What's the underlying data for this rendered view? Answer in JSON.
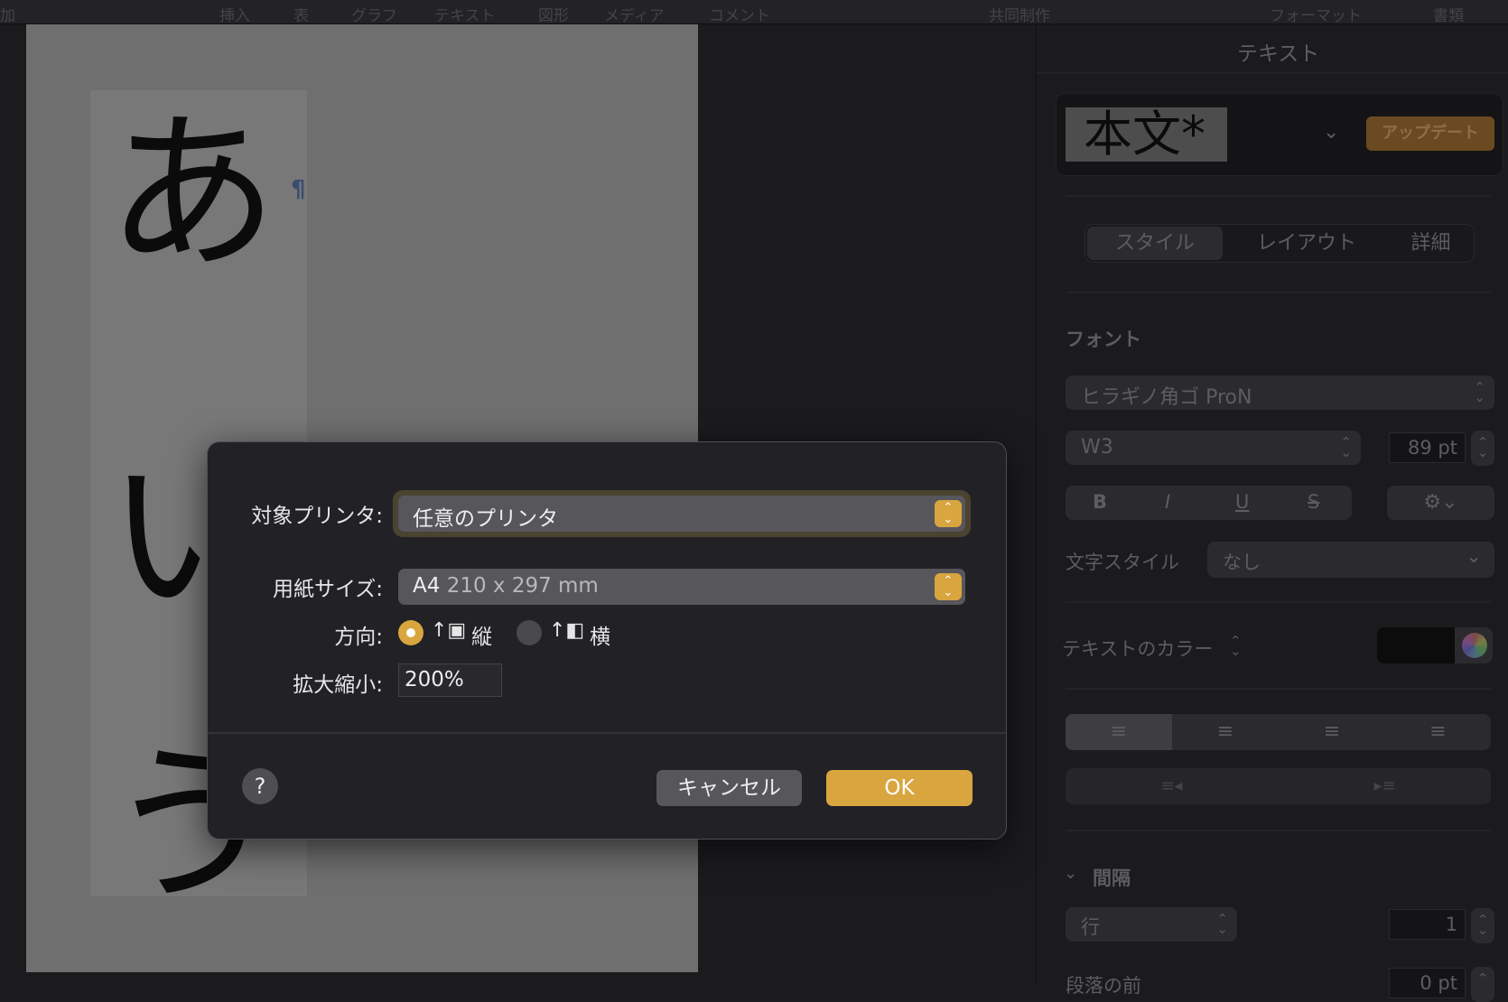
{
  "menubar": {
    "items": [
      "加",
      "挿入",
      "表",
      "グラフ",
      "テキスト",
      "図形",
      "メディア",
      "コメント",
      "共同制作",
      "フォーマット",
      "書類"
    ]
  },
  "document": {
    "chars": [
      "あ",
      "い",
      "う"
    ],
    "pilcrow": "¶"
  },
  "sidebar": {
    "title": "テキスト",
    "style_name": "本文*",
    "update_label": "アップデート",
    "tabs": [
      "スタイル",
      "レイアウト",
      "詳細"
    ],
    "font_section": "フォント",
    "font_family": "ヒラギノ角ゴ ProN",
    "font_weight": "W3",
    "font_size": "89 pt",
    "format_buttons": [
      "B",
      "I",
      "U",
      "S"
    ],
    "char_style_label": "文字スタイル",
    "char_style_value": "なし",
    "text_color_label": "テキストのカラー",
    "text_color": "#0c0c0c",
    "spacing_section": "間隔",
    "line_mode": "行",
    "line_value": "1",
    "para_before_label": "段落の前",
    "para_before_value": "0 pt"
  },
  "dialog": {
    "printer_label": "対象プリンタ:",
    "printer_value": "任意のプリンタ",
    "paper_label": "用紙サイズ:",
    "paper_name": "A4",
    "paper_dims": "210 x 297 mm",
    "orientation_label": "方向:",
    "portrait": "縦",
    "landscape": "横",
    "scale_label": "拡大縮小:",
    "scale_value": "200%",
    "help": "?",
    "cancel": "キャンセル",
    "ok": "OK",
    "accent": "#d9a53f"
  }
}
